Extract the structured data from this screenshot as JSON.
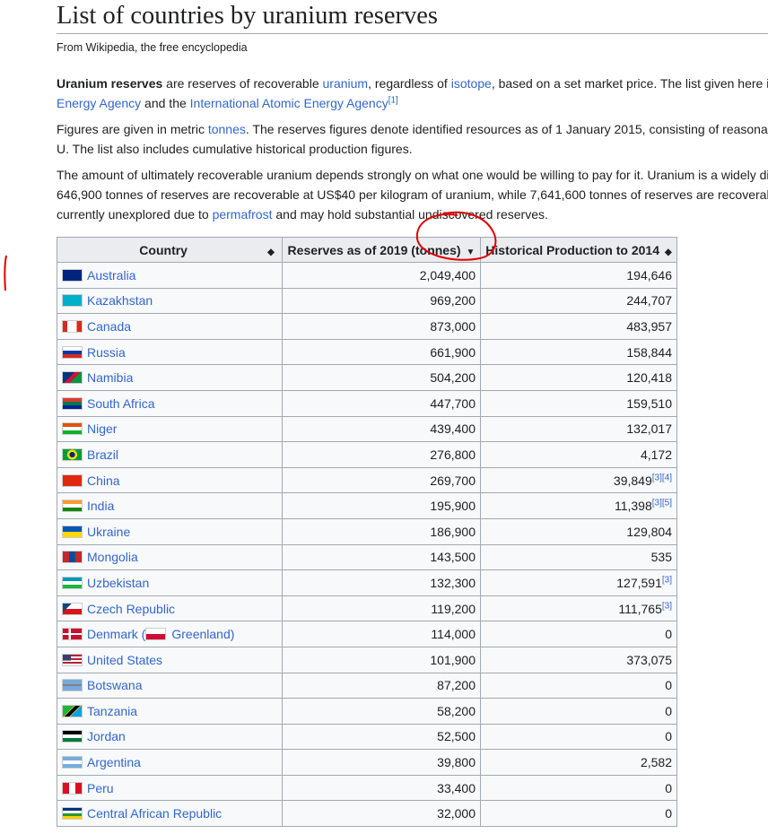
{
  "page": {
    "title": "List of countries by uranium reserves",
    "tagline": "From Wikipedia, the free encyclopedia"
  },
  "intro": {
    "p1_bold": "Uranium reserves",
    "p1_t1": " are reserves of recoverable ",
    "p1_l1": "uranium",
    "p1_t2": ", regardless of ",
    "p1_l2": "isotope",
    "p1_t3": ", based on a set market price. The list given here i",
    "p1_l3": "Energy Agency",
    "p1_t4": " and the ",
    "p1_l4": "International Atomic Energy Agency",
    "p1_ref": "[1]",
    "p2_t1": "Figures are given in metric ",
    "p2_l1": "tonnes",
    "p2_t2": ". The reserves figures denote identified resources as of 1 January 2015, consisting of reasona",
    "p2_line2": "U. The list also includes cumulative historical production figures.",
    "p3_line1": "The amount of ultimately recoverable uranium depends strongly on what one would be willing to pay for it. Uranium is a widely di",
    "p3_line2": "646,900 tonnes of reserves are recoverable at US$40 per kilogram of uranium, while 7,641,600 tonnes of reserves are recoveral",
    "p3_t1": "currently unexplored due to ",
    "p3_l1": "permafrost",
    "p3_t2": " and may hold substantial undiscovered reserves."
  },
  "table": {
    "headers": {
      "country": "Country",
      "reserves": "Reserves as of 2019 (tonnes)",
      "production": "Historical Production to 2014"
    },
    "sort_icons": {
      "country": "◆",
      "reserves": "▼",
      "production": "◆"
    },
    "rows": [
      {
        "country": "Australia",
        "reserves": "2,049,400",
        "production": "194,646",
        "ref": ""
      },
      {
        "country": "Kazakhstan",
        "reserves": "969,200",
        "production": "244,707",
        "ref": ""
      },
      {
        "country": "Canada",
        "reserves": "873,000",
        "production": "483,957",
        "ref": ""
      },
      {
        "country": "Russia",
        "reserves": "661,900",
        "production": "158,844",
        "ref": ""
      },
      {
        "country": "Namibia",
        "reserves": "504,200",
        "production": "120,418",
        "ref": ""
      },
      {
        "country": "South Africa",
        "reserves": "447,700",
        "production": "159,510",
        "ref": ""
      },
      {
        "country": "Niger",
        "reserves": "439,400",
        "production": "132,017",
        "ref": ""
      },
      {
        "country": "Brazil",
        "reserves": "276,800",
        "production": "4,172",
        "ref": ""
      },
      {
        "country": "China",
        "reserves": "269,700",
        "production": "39,849",
        "ref": "[3][4]"
      },
      {
        "country": "India",
        "reserves": "195,900",
        "production": "11,398",
        "ref": "[3][5]"
      },
      {
        "country": "Ukraine",
        "reserves": "186,900",
        "production": "129,804",
        "ref": ""
      },
      {
        "country": "Mongolia",
        "reserves": "143,500",
        "production": "535",
        "ref": ""
      },
      {
        "country": "Uzbekistan",
        "reserves": "132,300",
        "production": "127,591",
        "ref": "[3]"
      },
      {
        "country": "Czech Republic",
        "reserves": "119,200",
        "production": "111,765",
        "ref": "[3]"
      },
      {
        "country": "Denmark",
        "reserves": "114,000",
        "production": "0",
        "ref": "",
        "extra": "Greenland"
      },
      {
        "country": "United States",
        "reserves": "101,900",
        "production": "373,075",
        "ref": ""
      },
      {
        "country": "Botswana",
        "reserves": "87,200",
        "production": "0",
        "ref": ""
      },
      {
        "country": "Tanzania",
        "reserves": "58,200",
        "production": "0",
        "ref": ""
      },
      {
        "country": "Jordan",
        "reserves": "52,500",
        "production": "0",
        "ref": ""
      },
      {
        "country": "Argentina",
        "reserves": "39,800",
        "production": "2,582",
        "ref": ""
      },
      {
        "country": "Peru",
        "reserves": "33,400",
        "production": "0",
        "ref": ""
      },
      {
        "country": "Central African Republic",
        "reserves": "32,000",
        "production": "0",
        "ref": ""
      }
    ]
  },
  "colors": {
    "link": "#3366cc",
    "annotation": "#e00000",
    "header_bg": "#eaecf0",
    "border": "#a2a9b1"
  }
}
